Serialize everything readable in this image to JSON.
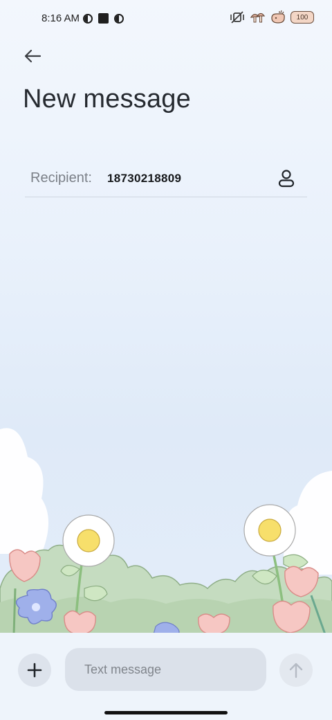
{
  "status_bar": {
    "time": "8:16 AM",
    "battery_level": "100",
    "icons": [
      "vpn-circle-icon",
      "square-notification-icon",
      "vpn-circle-icon",
      "mute-vibrate-icon",
      "mushroom-icon",
      "sticker-icon",
      "battery-icon"
    ]
  },
  "header": {
    "title": "New message",
    "back_icon": "arrow-left-icon"
  },
  "recipient": {
    "label": "Recipient:",
    "value": "18730218809",
    "contact_icon": "person-icon"
  },
  "composer": {
    "placeholder": "Text message",
    "attach_icon": "plus-icon",
    "send_icon": "arrow-up-icon"
  },
  "colors": {
    "background_top": "#f3f7fd",
    "background_bottom": "#e5eefa",
    "composer_bg": "#eef4fb",
    "input_bg": "#dbe1ea",
    "divider": "#cfd6e0"
  }
}
